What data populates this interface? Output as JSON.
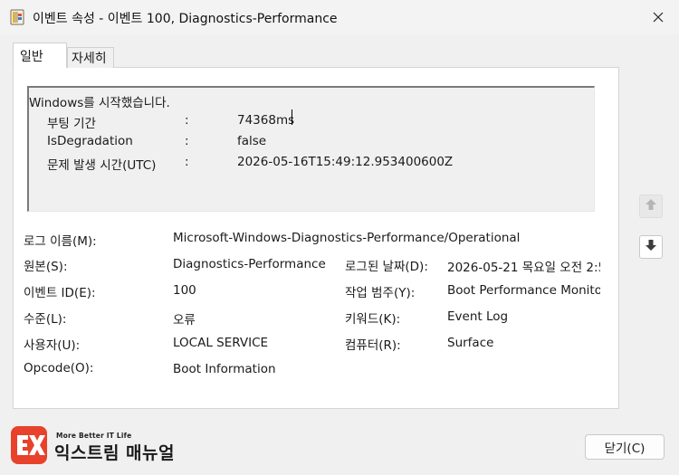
{
  "window": {
    "title": "이벤트 속성 - 이벤트 100, Diagnostics-Performance"
  },
  "tabs": [
    {
      "label": "일반",
      "active": true
    },
    {
      "label": "자세히",
      "active": false
    }
  ],
  "description": {
    "headline": "Windows를 시작했습니다.",
    "rows": [
      {
        "key": "부팅 기간",
        "sep": ":",
        "value": "74368ms"
      },
      {
        "key": "IsDegradation",
        "sep": ":",
        "value": "false"
      },
      {
        "key": "문제 발생 시간(UTC)",
        "sep": ":",
        "value": "2026-05-16T15:49:12.953400600Z"
      }
    ]
  },
  "properties": {
    "log_name_label": "로그 이름(M):",
    "log_name_value": "Microsoft-Windows-Diagnostics-Performance/Operational",
    "source_label": "원본(S):",
    "source_value": "Diagnostics-Performance",
    "logged_label": "로그된 날짜(D):",
    "logged_value": "2026-05-21 목요일 오전 2:5",
    "event_id_label": "이벤트 ID(E):",
    "event_id_value": "100",
    "task_label": "작업 범주(Y):",
    "task_value": "Boot Performance Monitor",
    "level_label": "수준(L):",
    "level_value": "오류",
    "keywords_label": "키워드(K):",
    "keywords_value": "Event Log",
    "user_label": "사용자(U):",
    "user_value": "LOCAL SERVICE",
    "computer_label": "컴퓨터(R):",
    "computer_value": "Surface",
    "opcode_label": "Opcode(O):",
    "opcode_value": "Boot Information"
  },
  "buttons": {
    "close_label": "닫기(C)"
  },
  "icons": {
    "title_icon": "event-viewer-icon",
    "close_icon": "close-icon",
    "up_icon": "arrow-up-icon",
    "down_icon": "arrow-down-icon"
  },
  "watermark": {
    "tagline": "More Better IT Life",
    "name": "익스트림 매뉴얼",
    "accent": "#e8412c"
  }
}
